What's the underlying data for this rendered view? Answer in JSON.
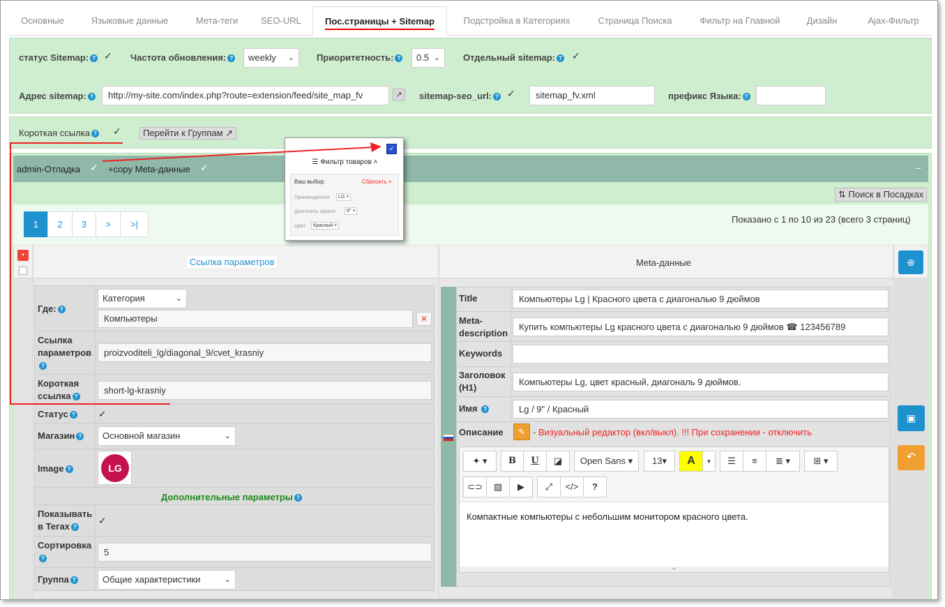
{
  "tabs": [
    "Основные",
    "Языковые данные",
    "Мета-теги",
    "SEO-URL",
    "Пос.страницы + Sitemap",
    "Подстройка в Категориях",
    "Страница Поиска",
    "Фильтр на Главной",
    "Дизайн",
    "Ajax-Фильтр"
  ],
  "sitemap": {
    "status_label": "статус Sitemap:",
    "freq_label": "Частота обновления:",
    "freq_value": "weekly",
    "priority_label": "Приоритетность:",
    "priority_value": "0.5",
    "separate_label": "Отдельный sitemap:",
    "address_label": "Адрес sitemap:",
    "address_value": "http://my-site.com/index.php?route=extension/feed/site_map_fv",
    "seo_url_label": "sitemap-seo_url:",
    "seo_url_value": "sitemap_fv.xml",
    "lang_prefix_label": "префикс Языка:",
    "lang_prefix_value": ""
  },
  "short_link": {
    "label": "Короткая ссылка",
    "goto_groups": "Перейти к Группам"
  },
  "debug": {
    "admin_label": "admin-Отладка",
    "copy_label": "+copy Meta-данные",
    "collapse": "–",
    "search_btn": "⇅ Поиск в Посадках"
  },
  "popup": {
    "title": "☰ Фильтр товаров ˄",
    "your_choice": "Ваш выбор:",
    "reset": "Сбросить ×",
    "manufacturers": "Производители",
    "manufacturers_val": "LG ×",
    "diagonal": "Диагональ экрана:",
    "diagonal_val": "9\" ×",
    "color": "Цвет:",
    "color_val": "Красный ×"
  },
  "pagination": {
    "pages": [
      "1",
      "2",
      "3",
      ">",
      ">|"
    ],
    "info": "Показано с 1 по 10 из 23 (всего 3 страниц)"
  },
  "table": {
    "col_params": "Ссылка параметров",
    "col_meta": "Meta-данные"
  },
  "left": {
    "where_label": "Где:",
    "where_value": "Категория",
    "where_text": "Компьютеры",
    "params_label": "Ссылка параметров",
    "params_value": "proizvoditeli_lg/diagonal_9/cvet_krasniy",
    "short_label": "Короткая ссылка",
    "short_value": "short-lg-krasniy",
    "status_label": "Статус",
    "shop_label": "Магазин",
    "shop_value": "Основной магазин",
    "image_label": "Image",
    "image_logo": "LG",
    "extra_params": "Дополнительные параметры",
    "show_tags_label": "Показывать в Тегах",
    "sort_label": "Сортировка",
    "sort_value": "5",
    "group_label": "Группа",
    "group_value": "Общие характеристики"
  },
  "meta": {
    "title_label": "Title",
    "title_value": "Компьютеры Lg | Красного цвета с диагональю 9 дюймов",
    "desc_label": "Meta-description",
    "desc_value": "Купить компьютеры Lg красного цвета с диагональю 9 дюймов ☎ 123456789",
    "keywords_label": "Keywords",
    "keywords_value": "",
    "h1_label": "Заголовок (H1)",
    "h1_value": "Компьютеры Lg, цвет красный, диагональ 9 дюймов.",
    "name_label": "Имя",
    "name_value": "Lg / 9\" / Красный",
    "desc2_label": "Описание",
    "editor_note": "- Визуальный редактор (вкл/выкл). !!! При сохранении - отключить",
    "font": "Open Sans ▾",
    "size": "13▾",
    "editor_text": "Компактные компьютеры с небольшим монитором красного цвета."
  },
  "colors": {
    "accent": "#1e91cf",
    "green_panel": "#cfeed0",
    "debug_bar": "#8fb8a8",
    "red": "#e22"
  }
}
